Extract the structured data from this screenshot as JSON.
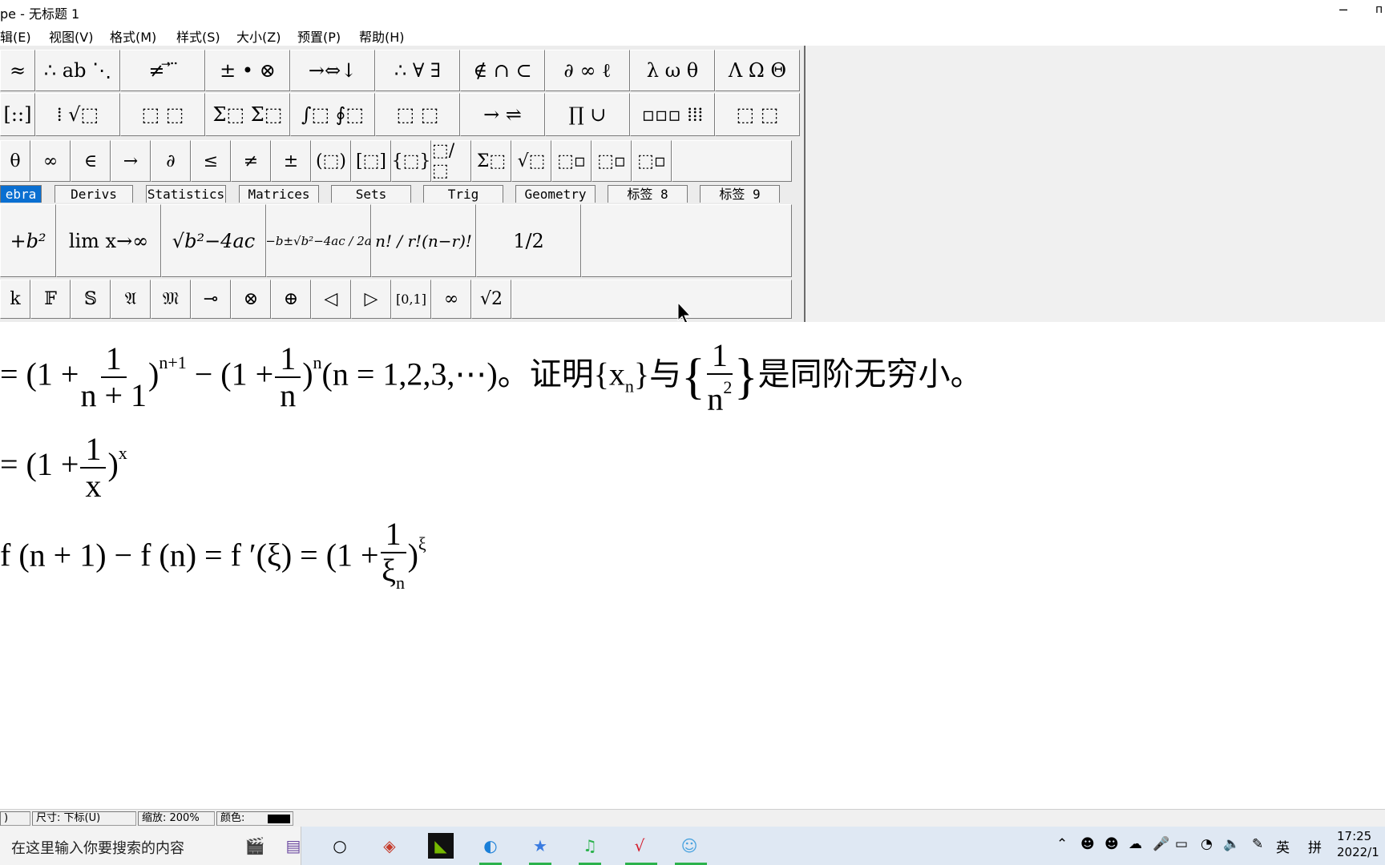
{
  "window": {
    "title": "pe - 无标题 1",
    "minimize_glyph": "─",
    "edge_glyph": "п"
  },
  "menu": [
    "辑(E)",
    "视图(V)",
    "格式(M)",
    "样式(S)",
    "大小(Z)",
    "预置(P)",
    "帮助(H)"
  ],
  "palette_row1": [
    "≈",
    "∴ ab ⋱",
    "≠ ⃗ ⃛",
    "± • ⊗",
    "→⇔↓",
    "∴ ∀ ∃",
    "∉ ∩ ⊂",
    "∂ ∞ ℓ",
    "λ ω θ",
    "Λ Ω Θ"
  ],
  "palette_row2": [
    "[::]",
    "⁞ √⬚",
    "⬚ ⬚",
    "Σ⬚ Σ⬚",
    "∫⬚ ∮⬚",
    "⬚ ⬚",
    "→ ⇌",
    "∏ ∪",
    "▫▫▫ ⁞⁞⁞",
    "⬚ ⬚"
  ],
  "small_symbols": [
    "θ",
    "∞",
    "∈",
    "→",
    "∂",
    "≤",
    "≠",
    "±",
    "(⬚)",
    "[⬚]",
    "{⬚}",
    "⬚/⬚",
    "Σ⬚",
    "√⬚",
    "⬚▫",
    "⬚▫",
    "⬚▫"
  ],
  "tabs": [
    "ebra",
    "Derivs",
    "Statistics",
    "Matrices",
    "Sets",
    "Trig",
    "Geometry",
    "标签 8",
    "标签 9"
  ],
  "templates": [
    "+b²",
    "lim x→∞",
    "√b²−4ac",
    "−b±√b²−4ac / 2a",
    "n! / r!(n−r)!",
    "1/2"
  ],
  "small_symbols_2": [
    "k",
    "𝔽",
    "𝕊",
    "𝔄",
    "𝔐",
    "⊸",
    "⊗",
    "⊕",
    "◁",
    "▷",
    "[0,1]",
    "∞",
    "√2"
  ],
  "equations": {
    "line1_a": "= (1 +",
    "line1_frac1_num": "1",
    "line1_frac1_den": "n + 1",
    "line1_exp1": "n+1",
    "line1_b": "− (1 +",
    "line1_frac2_num": "1",
    "line1_frac2_den": "n",
    "line1_exp2": "n",
    "line1_c": "(n = 1,2,3,⋯)。证明{x",
    "line1_sub": "n",
    "line1_d": "}与",
    "line1_brace_open": "{",
    "line1_frac3_num": "1",
    "line1_frac3_den": "n",
    "line1_frac3_den_exp": "2",
    "line1_brace_close": "}",
    "line1_e": "是同阶无穷小。",
    "line2_a": "= (1 +",
    "line2_frac_num": "1",
    "line2_frac_den": "x",
    "line2_exp": "x",
    "line3_a": "f (n + 1) − f (n) = f ′(ξ) = (1 +",
    "line3_frac_num": "1",
    "line3_frac_den": "ξ",
    "line3_frac_den_sub": "n",
    "line3_exp": "ξ"
  },
  "status": {
    "f0": ")",
    "size": "尺寸: 下标(U)",
    "zoom": "缩放: 200%",
    "color": "颜色:"
  },
  "taskbar": {
    "search_placeholder": "在这里输入你要搜索的内容",
    "ime_lang": "英",
    "ime_mode": "拼",
    "time": "17:25",
    "date": "2022/1"
  }
}
